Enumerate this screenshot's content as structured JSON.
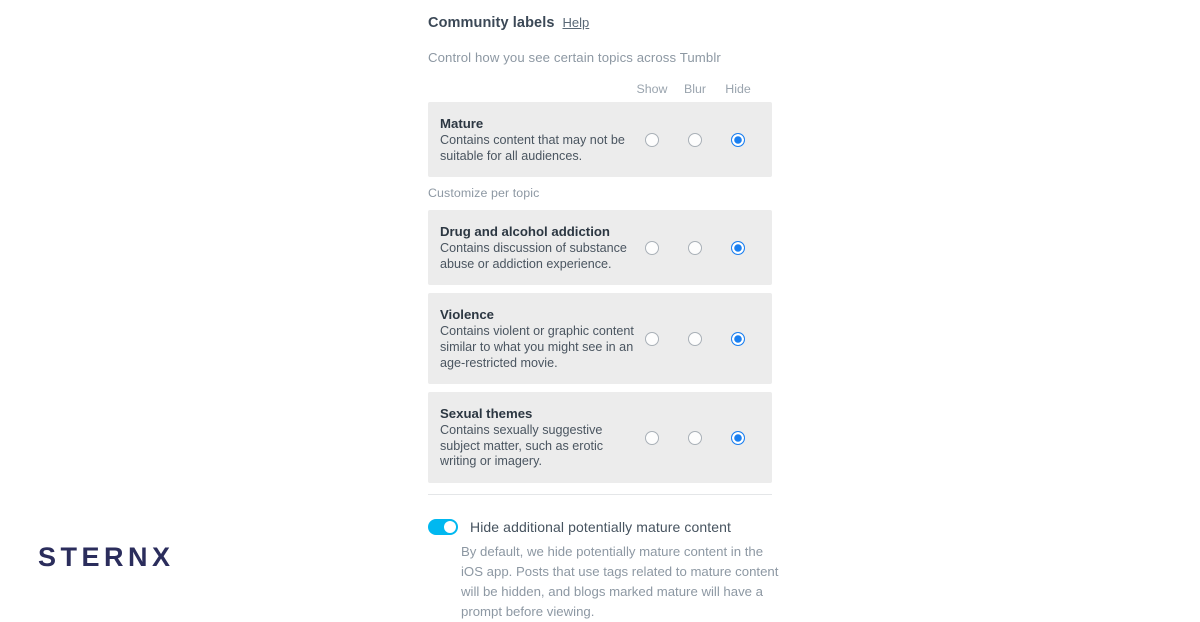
{
  "section": {
    "title": "Community labels",
    "help_label": "Help",
    "subtitle": "Control how you see certain topics across Tumblr",
    "customize_label": "Customize per topic"
  },
  "columns": [
    {
      "label": "Show"
    },
    {
      "label": "Blur"
    },
    {
      "label": "Hide"
    }
  ],
  "primary_card": {
    "title": "Mature",
    "description": "Contains content that may not be suitable for all audiences.",
    "selected": "Hide"
  },
  "topic_cards": [
    {
      "title": "Drug and alcohol addiction",
      "description": "Contains discussion of substance abuse or addiction experience.",
      "selected": "Hide"
    },
    {
      "title": "Violence",
      "description": "Contains violent or graphic content similar to what you might see in an age-restricted movie.",
      "selected": "Hide"
    },
    {
      "title": "Sexual themes",
      "description": "Contains sexually suggestive subject matter, such as erotic writing or imagery.",
      "selected": "Hide"
    }
  ],
  "mature_toggle": {
    "label": "Hide additional potentially mature content",
    "description": "By default, we hide potentially mature content in the iOS app. Posts that use tags related to mature content will be hidden, and blogs marked mature will have a prompt before viewing.",
    "state": "on"
  },
  "watermark": {
    "text": "STERNX"
  },
  "colors": {
    "accent_blue": "#1a7ff0",
    "toggle_on": "#00b8f0",
    "card_background": "#ececec",
    "watermark": "#2b2d5c"
  }
}
